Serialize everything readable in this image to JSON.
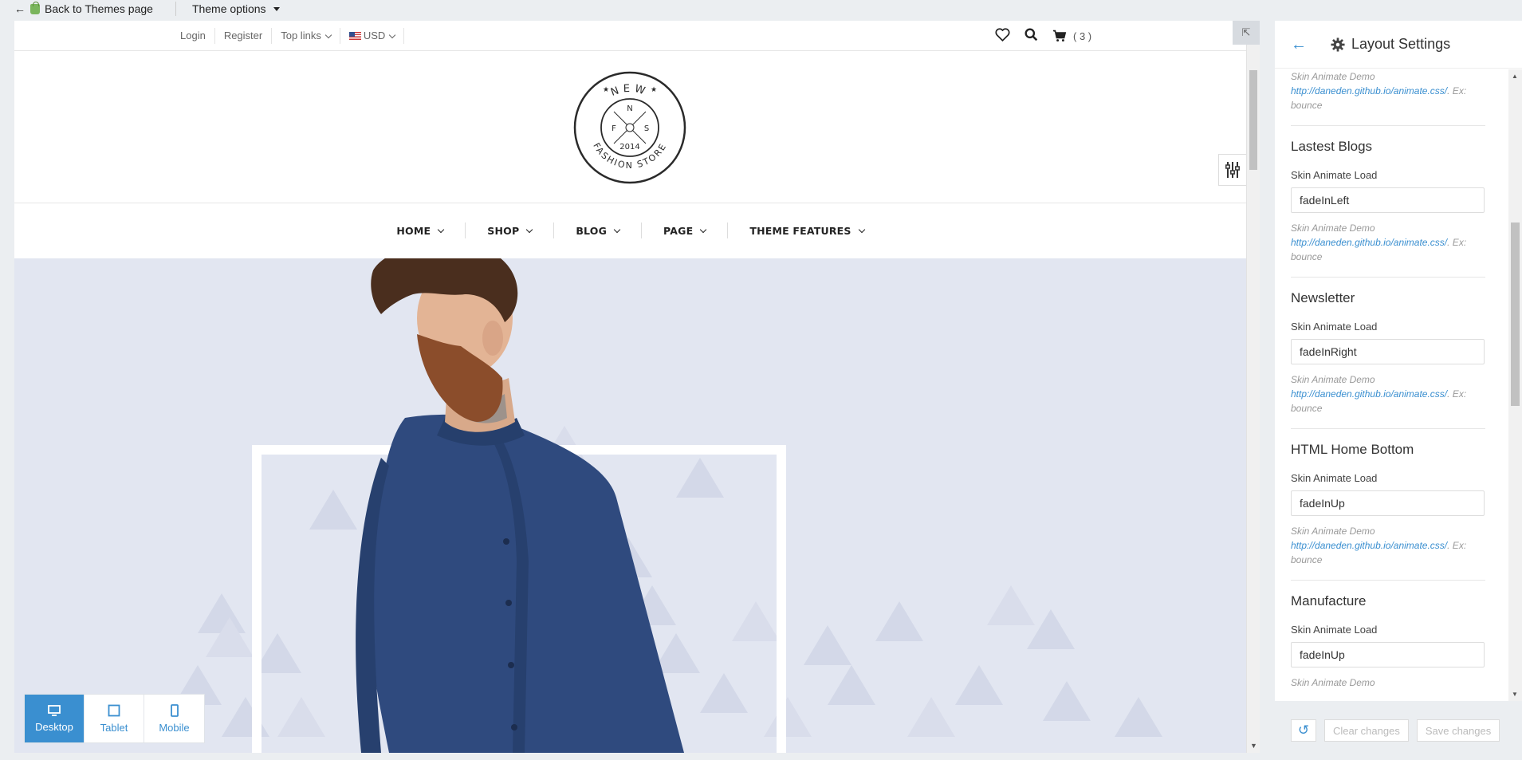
{
  "topbar": {
    "back_label": "Back to Themes page",
    "theme_options_label": "Theme options"
  },
  "store": {
    "top_links": {
      "login": "Login",
      "register": "Register",
      "top_links": "Top links",
      "currency": "USD"
    },
    "cart_count": "( 3 )",
    "logo": {
      "line1": "NEW",
      "line2": "FASHION STORE",
      "year": "2014",
      "n": "N",
      "f": "F",
      "s": "S"
    },
    "nav": [
      {
        "label": "HOME"
      },
      {
        "label": "SHOP"
      },
      {
        "label": "BLOG"
      },
      {
        "label": "PAGE"
      },
      {
        "label": "THEME FEATURES"
      }
    ]
  },
  "devices": {
    "desktop": "Desktop",
    "tablet": "Tablet",
    "mobile": "Mobile",
    "active": "desktop"
  },
  "panel": {
    "title": "Layout Settings",
    "top_note": {
      "label": "Skin Animate Demo",
      "link": "http://daneden.github.io/animate.css/",
      "suffix": ". Ex: bounce"
    },
    "sections": [
      {
        "title": "Lastest Blogs",
        "field_label": "Skin Animate Load",
        "value": "fadeInLeft",
        "note_label": "Skin Animate Demo",
        "note_link": "http://daneden.github.io/animate.css/",
        "note_suffix": ". Ex: bounce"
      },
      {
        "title": "Newsletter",
        "field_label": "Skin Animate Load",
        "value": "fadeInRight",
        "note_label": "Skin Animate Demo",
        "note_link": "http://daneden.github.io/animate.css/",
        "note_suffix": ". Ex: bounce"
      },
      {
        "title": "HTML Home Bottom",
        "field_label": "Skin Animate Load",
        "value": "fadeInUp",
        "note_label": "Skin Animate Demo",
        "note_link": "http://daneden.github.io/animate.css/",
        "note_suffix": ". Ex: bounce"
      },
      {
        "title": "Manufacture",
        "field_label": "Skin Animate Load",
        "value": "fadeInUp",
        "note_label": "Skin Animate Demo"
      }
    ],
    "footer": {
      "clear": "Clear changes",
      "save": "Save changes"
    }
  },
  "colors": {
    "accent": "#3a8fd0",
    "hero_bg": "#e2e6f1",
    "shirt": "#2f4a7e"
  }
}
